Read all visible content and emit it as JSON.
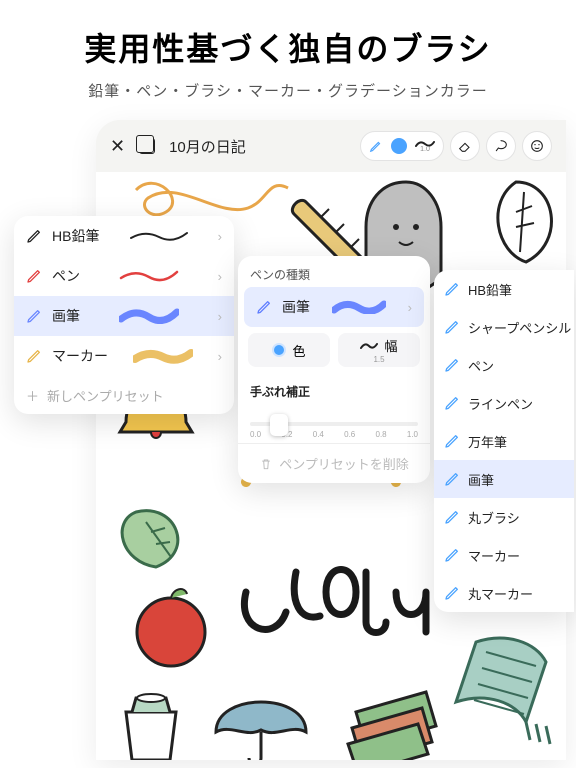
{
  "hero": {
    "title": "実用性基づく独自のブラシ",
    "subtitle": "鉛筆・ペン・ブラシ・マーカー・グラデーションカラー"
  },
  "toolbar": {
    "doc_title": "10月の日記",
    "stroke_width_label": "1.0"
  },
  "panel1": {
    "items": [
      {
        "label": "HB鉛筆",
        "color": "#222222"
      },
      {
        "label": "ペン",
        "color": "#e2403f"
      },
      {
        "label": "画筆",
        "color": "#6a86ff",
        "selected": true
      },
      {
        "label": "マーカー",
        "color": "#e7b54a"
      }
    ],
    "add_label": "新しペンプリセット"
  },
  "panel2": {
    "section_type": "ペンの種類",
    "brush_label": "画筆",
    "color_label": "色",
    "width_label": "幅",
    "width_value": "1.5",
    "stabilize_label": "手ぶれ補正",
    "slider_ticks": [
      "0.0",
      "0.2",
      "0.4",
      "0.6",
      "0.8",
      "1.0"
    ],
    "delete_label": "ペンプリセットを削除"
  },
  "panel3": {
    "items": [
      {
        "label": "HB鉛筆"
      },
      {
        "label": "シャープペンシル"
      },
      {
        "label": "ペン"
      },
      {
        "label": "ラインペン"
      },
      {
        "label": "万年筆"
      },
      {
        "label": "画筆",
        "selected": true
      },
      {
        "label": "丸ブラシ"
      },
      {
        "label": "マーカー"
      },
      {
        "label": "丸マーカー"
      }
    ]
  },
  "colors": {
    "accent": "#5f7dff",
    "selection": "#e6ecff",
    "blue_dot": "#4aa3ff"
  }
}
